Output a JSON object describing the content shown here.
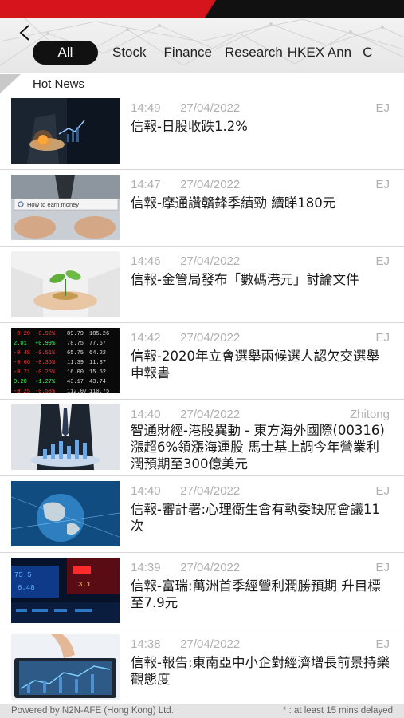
{
  "header": {
    "tabs": [
      {
        "label": "All",
        "active": true
      },
      {
        "label": "Stock",
        "active": false
      },
      {
        "label": "Finance",
        "active": false
      },
      {
        "label": "Research",
        "active": false
      },
      {
        "label": "HKEX Ann",
        "active": false
      },
      {
        "label": "C",
        "active": false
      }
    ]
  },
  "section": {
    "title": "Hot News"
  },
  "news": [
    {
      "time": "14:49",
      "date": "27/04/2022",
      "source": "EJ",
      "headline": "信報-日股收跌1.2%",
      "thumb": "business-hand-icon"
    },
    {
      "time": "14:47",
      "date": "27/04/2022",
      "source": "EJ",
      "headline": "信報-摩通讚贛鋒季績勁 續睇180元",
      "thumb": "search-bar-icon",
      "thumb_text": "How to earn money"
    },
    {
      "time": "14:46",
      "date": "27/04/2022",
      "source": "EJ",
      "headline": "信報-金管局發布「數碼港元」討論文件",
      "thumb": "plant-coins-icon"
    },
    {
      "time": "14:42",
      "date": "27/04/2022",
      "source": "EJ",
      "headline": "信報-2020年立會選舉兩候選人認欠交選舉申報書",
      "thumb": "stock-board-icon"
    },
    {
      "time": "14:40",
      "date": "27/04/2022",
      "source": "Zhitong",
      "headline": "智通財經-港股異動 - 東方海外國際(00316)漲超6%領漲海運股 馬士基上調今年營業利潤預期至300億美元",
      "thumb": "businessman-chart-icon"
    },
    {
      "time": "14:40",
      "date": "27/04/2022",
      "source": "EJ",
      "headline": "信報-審計署:心理衛生會有執委缺席會議11次",
      "thumb": "globe-icon"
    },
    {
      "time": "14:39",
      "date": "27/04/2022",
      "source": "EJ",
      "headline": "信報-富瑞:萬洲首季經營利潤勝預期 升目標至7.9元",
      "thumb": "stock-ticker-icon"
    },
    {
      "time": "14:38",
      "date": "27/04/2022",
      "source": "EJ",
      "headline": "信報-報告:東南亞中小企對經濟增長前景持樂觀態度",
      "thumb": "tablet-chart-icon"
    }
  ],
  "footer": {
    "powered_by": "Powered by N2N-AFE (Hong Kong) Ltd.",
    "delay_note": "* : at least 15 mins delayed"
  },
  "colors": {
    "brand_red": "#d5141c",
    "tab_active_bg": "#111111",
    "meta_gray": "#b0b0b0"
  }
}
